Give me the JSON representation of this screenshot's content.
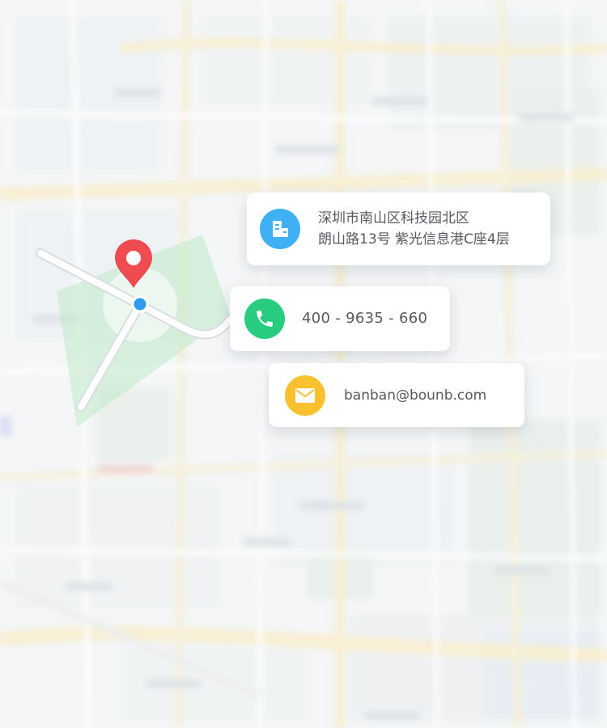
{
  "contact": {
    "address_line1": "深圳市南山区科技园北区",
    "address_line2": "朗山路13号 紫光信息港C座4层",
    "phone": "400 - 9635 - 660",
    "email": "banban@bounb.com"
  },
  "icons": {
    "address": "building-icon",
    "phone": "phone-icon",
    "email": "mail-icon",
    "pin": "location-pin-icon"
  },
  "colors": {
    "address_icon": "#3fb0f3",
    "phone_icon": "#27cc80",
    "email_icon": "#fbc02d",
    "pin": "#ef4b50",
    "location_dot": "#2d9cf0",
    "route": "#ffffff",
    "coverage": "#bfe9c9"
  }
}
